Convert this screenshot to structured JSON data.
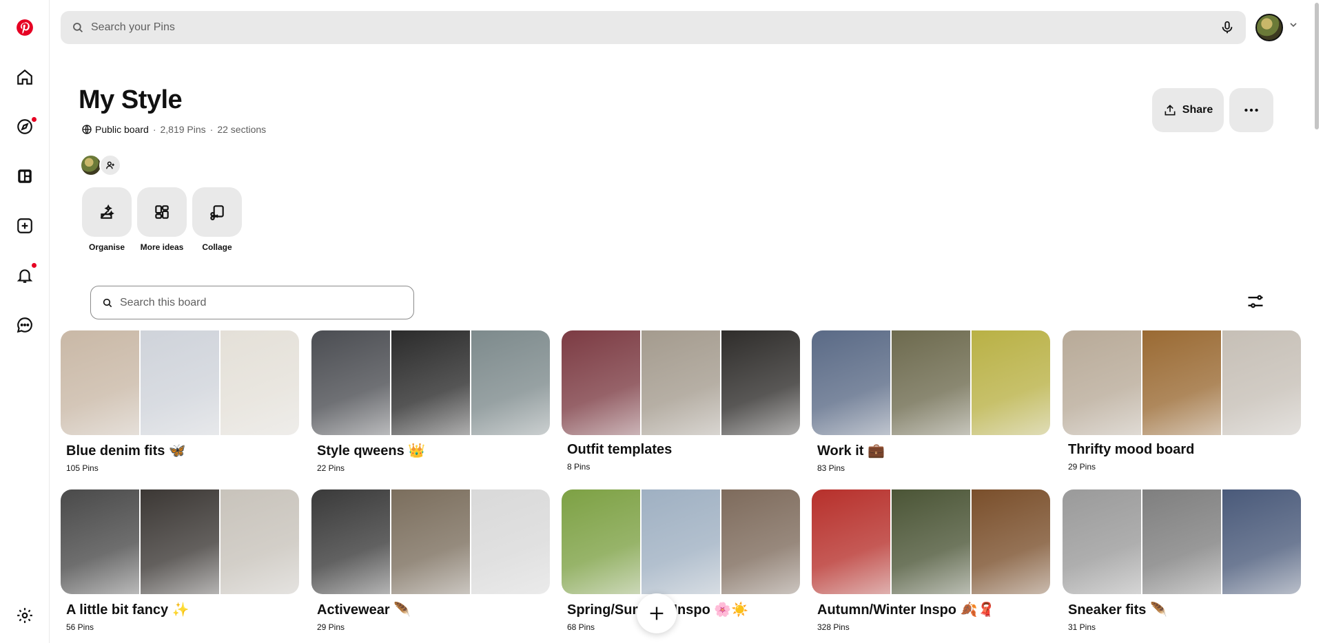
{
  "search": {
    "placeholder": "Search your Pins"
  },
  "board": {
    "title": "My Style",
    "visibility": "Public board",
    "pins": "2,819 Pins",
    "sections": "22 sections",
    "share_label": "Share"
  },
  "tools": [
    {
      "label": "Organise"
    },
    {
      "label": "More ideas"
    },
    {
      "label": "Collage"
    }
  ],
  "board_search": {
    "placeholder": "Search this board"
  },
  "sections": [
    {
      "name": "Blue denim fits 🦋",
      "count": "105 Pins",
      "colors": [
        "#c9b8a6",
        "#cfd3da",
        "#e4e0d8"
      ]
    },
    {
      "name": "Style qweens 👑",
      "count": "22 Pins",
      "colors": [
        "#4b4d52",
        "#2b2b2b",
        "#7d8a8c"
      ]
    },
    {
      "name": "Outfit templates",
      "count": "8 Pins",
      "colors": [
        "#7c3b43",
        "#a49b8e",
        "#2f2d2b"
      ]
    },
    {
      "name": "Work it 💼",
      "count": "83 Pins",
      "colors": [
        "#5a6a86",
        "#6d6a4e",
        "#b9b145"
      ]
    },
    {
      "name": "Thrifty mood board",
      "count": "29 Pins",
      "colors": [
        "#b8aa98",
        "#9a6a33",
        "#c6bfb6"
      ]
    },
    {
      "name": "A little bit fancy ✨",
      "count": "56 Pins",
      "colors": [
        "#4a4a4a",
        "#3c3835",
        "#c8c3bb"
      ]
    },
    {
      "name": "Activewear 🪶",
      "count": "29 Pins",
      "colors": [
        "#3a3a3a",
        "#7b6e5d",
        "#d9d9d9"
      ]
    },
    {
      "name": "Spring/Summer Inspo 🌸☀️",
      "count": "68 Pins",
      "colors": [
        "#7da144",
        "#9fb0c2",
        "#7e6b5c"
      ]
    },
    {
      "name": "Autumn/Winter Inspo 🍂🧣",
      "count": "328 Pins",
      "colors": [
        "#b7302b",
        "#4b5536",
        "#7a4f2b"
      ]
    },
    {
      "name": "Sneaker fits 🪶",
      "count": "31 Pins",
      "colors": [
        "#9a9a9a",
        "#7f7f7f",
        "#4a5a7a"
      ]
    }
  ]
}
